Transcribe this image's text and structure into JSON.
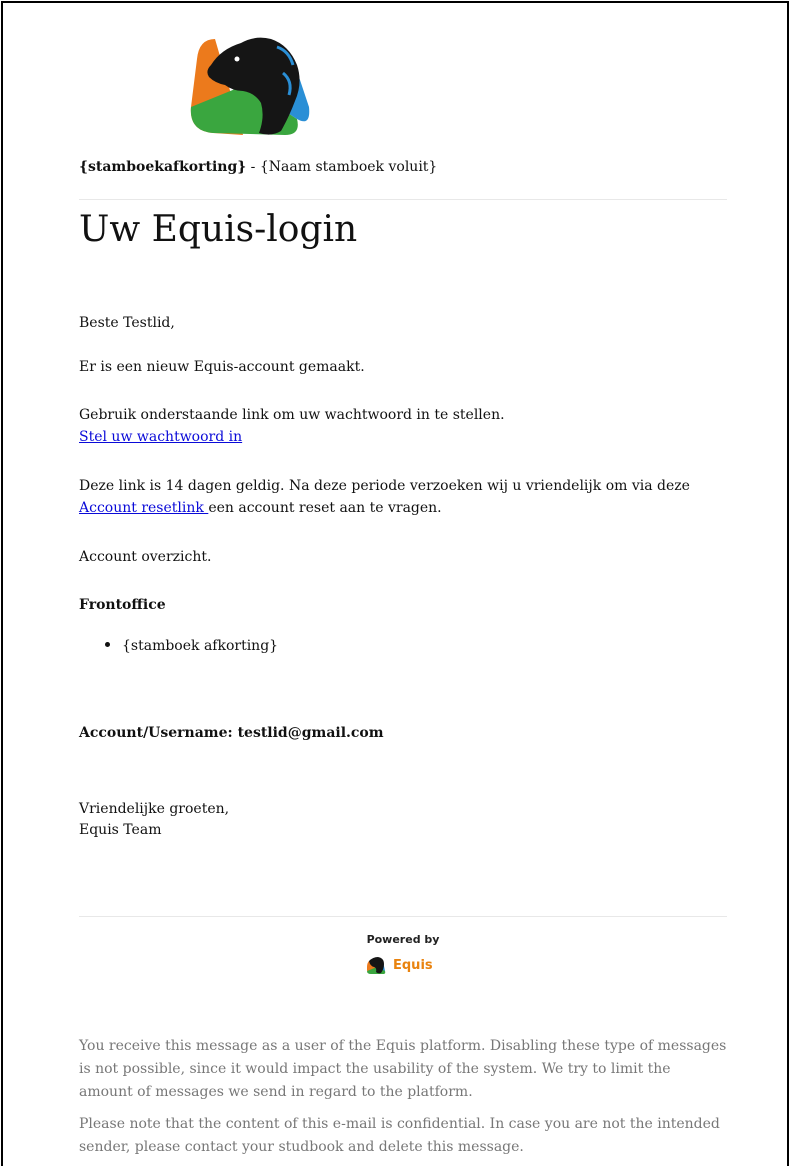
{
  "header": {
    "studbook_abbr": "{stamboekafkorting}",
    "separator": " - ",
    "studbook_full": "{Naam stamboek voluit}"
  },
  "title": "Uw Equis-login",
  "body": {
    "greeting": "Beste Testlid,",
    "account_created": "Er is een nieuw Equis-account gemaakt.",
    "use_link": "Gebruik onderstaande link om uw wachtwoord in te stellen.",
    "set_password_link": "Stel uw wachtwoord in",
    "validity_before": "Deze link is 14 dagen geldig. Na deze periode verzoeken wij u vriendelijk om via deze",
    "reset_link": "Account resetlink ",
    "validity_after": "een account reset aan te vragen.",
    "overview": "Account overzicht.",
    "frontoffice_heading": "Frontoffice",
    "frontoffice_items": [
      "{stamboek afkorting}"
    ],
    "account_line": "Account/Username: testlid@gmail.com",
    "closing": "Vriendelijke groeten,",
    "signature": "Equis Team"
  },
  "footer": {
    "powered_by": "Powered by",
    "brand_name": "Equis",
    "notice_1": "You receive this message as a user of the Equis platform. Disabling these type of messages is not possible, since it would impact the usability of the system. We try to limit the amount of messages we send in regard to the platform.",
    "notice_2": "Please note that the content of this e-mail is confidential. In case you are not the intended sender, please contact your studbook and delete this message."
  },
  "colors": {
    "link": "#0a0ad8",
    "brand": "#e9830f",
    "footer_text": "#777777",
    "logo_orange": "#ec7a1c",
    "logo_green": "#3aa63f",
    "logo_blue": "#2a8fd6"
  },
  "icons": {
    "logo": "equis-horse-logo-icon",
    "brand": "equis-brand-icon"
  }
}
